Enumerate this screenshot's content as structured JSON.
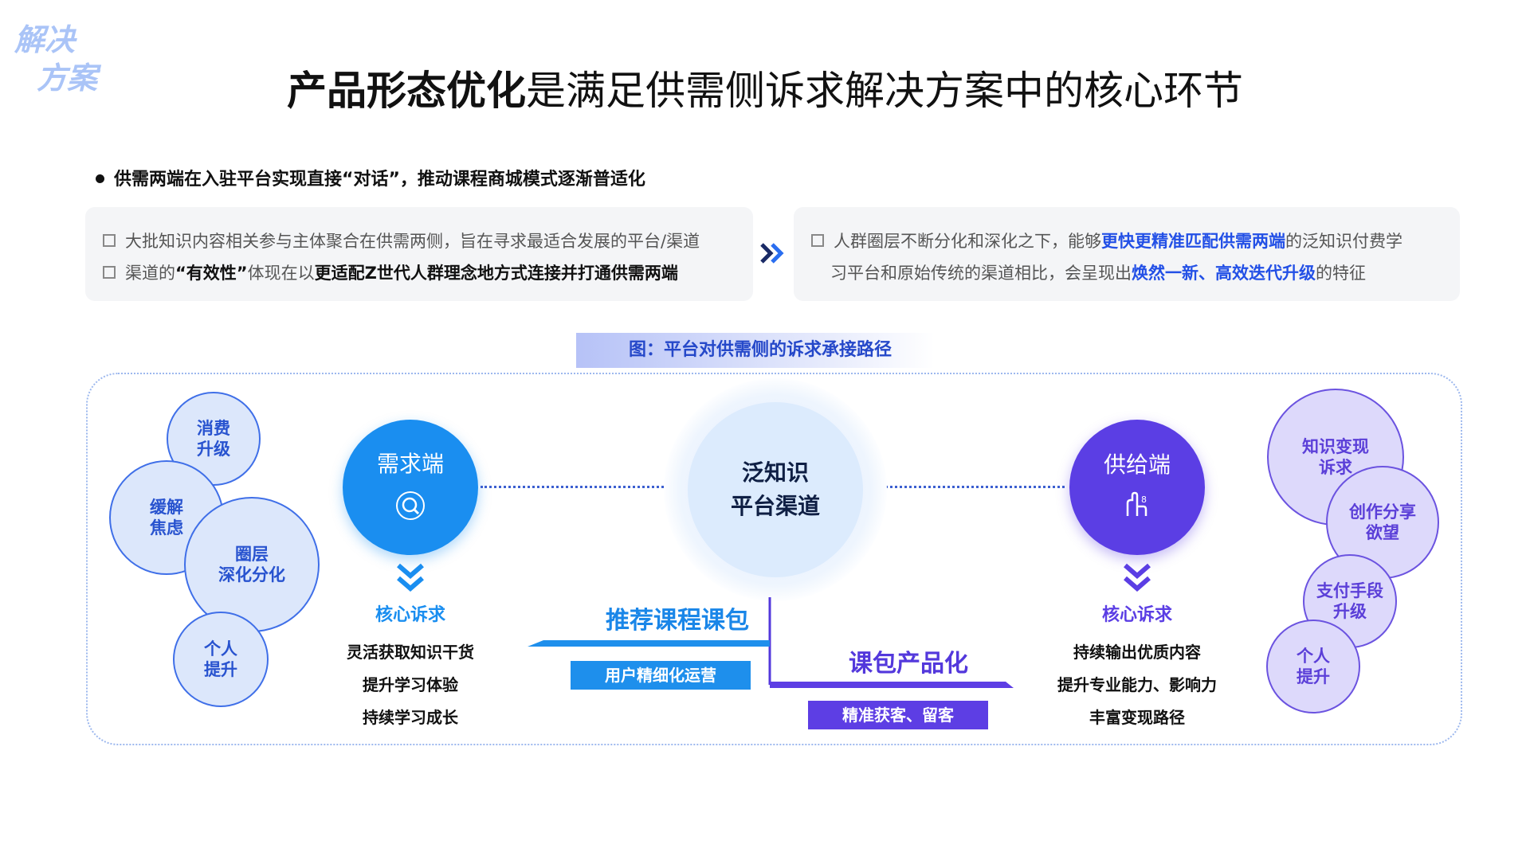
{
  "corner_tag": {
    "line1": "解决",
    "line2": "方案"
  },
  "title": {
    "bold": "产品形态优化",
    "rest": "是满足供需侧诉求解决方案中的核心环节"
  },
  "bullet": "供需两端在入驻平台实现直接“对话”，推动课程商城模式逐渐普适化",
  "left_card": {
    "row1": "大批知识内容相关参与主体聚合在供需两侧，旨在寻求最适合发展的平台/渠道",
    "row2_a": "渠道的",
    "row2_b": "“有效性”",
    "row2_c": "体现在以",
    "row2_d": "更适配Z世代人群理念地方式连接并打通供需两端"
  },
  "right_card": {
    "row1_a": "人群圈层不断分化和深化之下，能够",
    "row1_b": "更快更精准匹配供需两端",
    "row1_c": "的泛知识付费学",
    "row2_a": "习平台和原始传统的渠道相比，会呈现出",
    "row2_b": "焕然一新、高效迭代升级",
    "row2_c": "的特征"
  },
  "figure_title": "图：平台对供需侧的诉求承接路径",
  "left_bubbles": [
    {
      "line1": "消费",
      "line2": "升级"
    },
    {
      "line1": "缓解",
      "line2": "焦虑"
    },
    {
      "line1": "圈层",
      "line2": "深化分化"
    },
    {
      "line1": "个人",
      "line2": "提升"
    }
  ],
  "right_bubbles": [
    {
      "line1": "知识变现",
      "line2": "诉求"
    },
    {
      "line1": "创作分享",
      "line2": "欲望"
    },
    {
      "line1": "支付手段",
      "line2": "升级"
    },
    {
      "line1": "个人",
      "line2": "提升"
    }
  ],
  "demand": {
    "label": "需求端",
    "core_title": "核心诉求",
    "items": [
      "灵活获取知识干货",
      "提升学习体验",
      "持续学习成长"
    ]
  },
  "supply": {
    "label": "供给端",
    "core_title": "核心诉求",
    "items": [
      "持续输出优质内容",
      "提升专业能力、影响力",
      "丰富变现路径"
    ]
  },
  "center": {
    "line1": "泛知识",
    "line2": "平台渠道"
  },
  "path_left": {
    "title": "推荐课程课包",
    "tag": "用户精细化运营"
  },
  "path_right": {
    "title": "课包产品化",
    "tag": "精准获客、留客"
  },
  "colors": {
    "blue": "#1e8fec",
    "purple": "#5d3ee4",
    "accent": "#2350e6"
  }
}
